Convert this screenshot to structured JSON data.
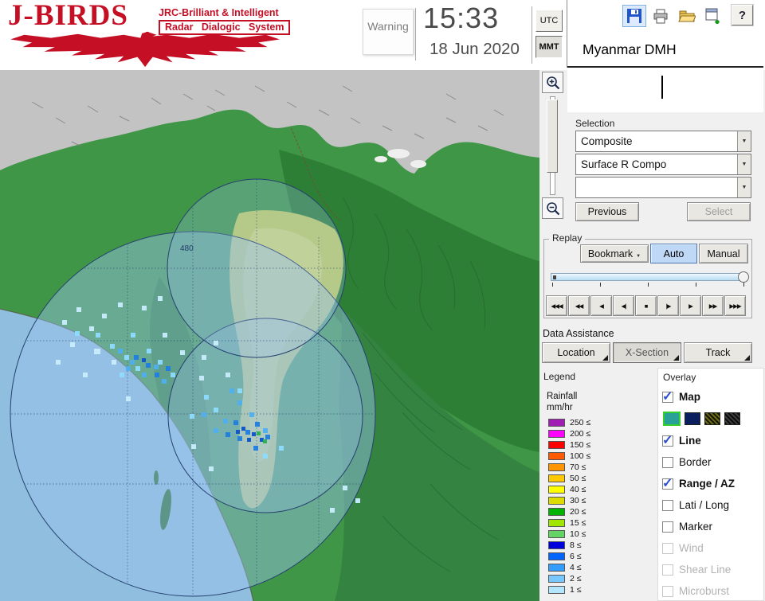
{
  "header": {
    "logo_title": "J-BIRDS",
    "logo_sub1": "JRC-Brilliant & Intelligent",
    "logo_sub2": "Radar Dialogic System",
    "warning": "Warning",
    "time": "15:33",
    "date": "18 Jun 2020",
    "utc": "UTC",
    "mmt": "MMT",
    "station": "Myanmar DMH",
    "toolbar": {
      "help_glyph": "?"
    }
  },
  "selection": {
    "label": "Selection",
    "combo_composite": "Composite",
    "combo_surface": "Surface R Compo",
    "combo_third": "",
    "previous": "Previous",
    "select": "Select"
  },
  "replay": {
    "label": "Replay",
    "bookmark": "Bookmark",
    "auto": "Auto",
    "manual": "Manual",
    "playback": [
      "◀◀◀",
      "◀◀",
      "◀",
      "◀|",
      "■",
      "|▶",
      "▶",
      "▶▶",
      "▶▶▶"
    ]
  },
  "data_assistance": {
    "label": "Data Assistance",
    "buttons": [
      "Location",
      "X-Section",
      "Track"
    ]
  },
  "legend": {
    "label": "Legend",
    "unit_line1": "Rainfall",
    "unit_line2": "mm/hr",
    "suffix": "≤",
    "entries": [
      {
        "label": "250",
        "color": "#a01eb4"
      },
      {
        "label": "200",
        "color": "#ff00ff"
      },
      {
        "label": "150",
        "color": "#ff0000"
      },
      {
        "label": "100",
        "color": "#ff5a00"
      },
      {
        "label": "70",
        "color": "#ff9600"
      },
      {
        "label": "50",
        "color": "#ffc800"
      },
      {
        "label": "40",
        "color": "#ffff00"
      },
      {
        "label": "30",
        "color": "#dcdc00"
      },
      {
        "label": "20",
        "color": "#00b400"
      },
      {
        "label": "15",
        "color": "#a0e600"
      },
      {
        "label": "10",
        "color": "#64d264"
      },
      {
        "label": "8",
        "color": "#0000dc"
      },
      {
        "label": "6",
        "color": "#0064ff"
      },
      {
        "label": "4",
        "color": "#329cff"
      },
      {
        "label": "2",
        "color": "#78c8ff"
      },
      {
        "label": "1",
        "color": "#b4e6ff"
      }
    ]
  },
  "overlay": {
    "label": "Overlay",
    "items_top": [
      {
        "label": "Map",
        "checked": true,
        "bold": true
      }
    ],
    "swatches": [
      {
        "color": "#2aa198",
        "selected": true
      },
      {
        "color": "#0b1f5e"
      },
      {
        "color": "#6b6b1a",
        "hatch": true
      },
      {
        "color": "#3c3c3c",
        "hatch": true
      }
    ],
    "items": [
      {
        "label": "Line",
        "checked": true,
        "bold": true
      },
      {
        "label": "Border"
      },
      {
        "label": "Range / AZ",
        "checked": true,
        "bold": true
      },
      {
        "label": "Lati / Long"
      },
      {
        "label": "Marker"
      },
      {
        "label": "Wind",
        "disabled": true
      },
      {
        "label": "Shear Line",
        "disabled": true
      },
      {
        "label": "Microburst",
        "disabled": true
      }
    ]
  },
  "map": {
    "range_label": "480"
  }
}
